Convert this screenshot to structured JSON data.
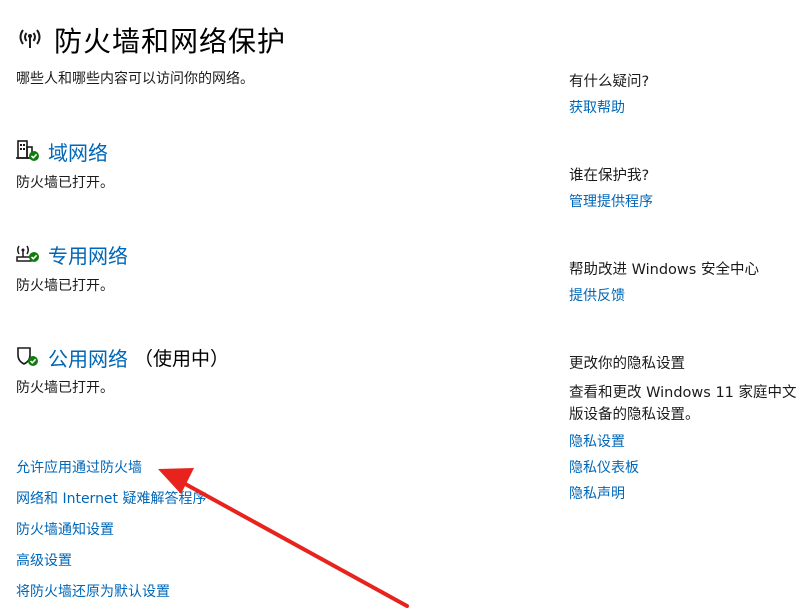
{
  "page": {
    "title": "防火墙和网络保护",
    "subtitle": "哪些人和哪些内容可以访问你的网络。"
  },
  "networks": [
    {
      "icon": "domain-network-icon",
      "name": "域网络",
      "suffix": "",
      "status": "防火墙已打开。"
    },
    {
      "icon": "private-network-icon",
      "name": "专用网络",
      "suffix": "",
      "status": "防火墙已打开。"
    },
    {
      "icon": "public-network-icon",
      "name": "公用网络",
      "suffix": "（使用中）",
      "status": "防火墙已打开。"
    }
  ],
  "links": [
    "允许应用通过防火墙",
    "网络和 Internet 疑难解答程序",
    "防火墙通知设置",
    "高级设置",
    "将防火墙还原为默认设置"
  ],
  "sidebar": {
    "help": {
      "heading": "有什么疑问?",
      "link": "获取帮助"
    },
    "protect": {
      "heading": "谁在保护我?",
      "link": "管理提供程序"
    },
    "improve": {
      "heading": "帮助改进 Windows 安全中心",
      "link": "提供反馈"
    },
    "privacy": {
      "heading": "更改你的隐私设置",
      "description": "查看和更改 Windows 11 家庭中文版设备的隐私设置。",
      "links": [
        "隐私设置",
        "隐私仪表板",
        "隐私声明"
      ]
    }
  },
  "colors": {
    "link": "#0067b8",
    "status_ok": "#107c10",
    "arrow": "#e8231d"
  }
}
